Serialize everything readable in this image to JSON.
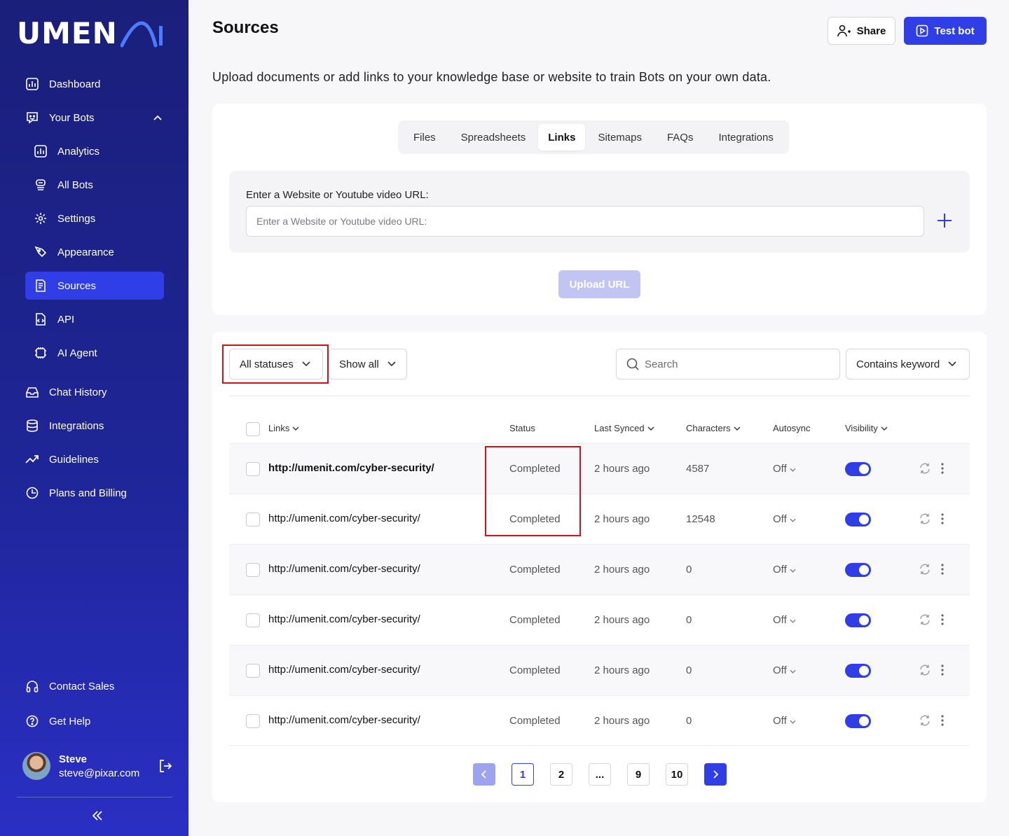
{
  "brand": {
    "logo_text": "UMEN",
    "accent": "#2f3ee6",
    "sidebar_bg": "#1e2596"
  },
  "sidebar": {
    "items": [
      {
        "label": "Dashboard",
        "icon": "dashboard-icon"
      },
      {
        "label": "Your Bots",
        "icon": "bot-icon"
      },
      {
        "label": "Analytics",
        "icon": "chart-icon"
      },
      {
        "label": "All Bots",
        "icon": "bots-icon"
      },
      {
        "label": "Settings",
        "icon": "gear-icon"
      },
      {
        "label": "Appearance",
        "icon": "brush-icon"
      },
      {
        "label": "Sources",
        "icon": "document-icon"
      },
      {
        "label": "API",
        "icon": "code-file-icon"
      },
      {
        "label": "AI Agent",
        "icon": "chip-icon"
      },
      {
        "label": "Chat History",
        "icon": "inbox-icon"
      },
      {
        "label": "Integrations",
        "icon": "database-icon"
      },
      {
        "label": "Guidelines",
        "icon": "trend-icon"
      },
      {
        "label": "Plans and Billing",
        "icon": "clock-icon"
      }
    ],
    "bottom": [
      {
        "label": "Contact Sales",
        "icon": "headset-icon"
      },
      {
        "label": "Get Help",
        "icon": "help-icon"
      }
    ],
    "user": {
      "name": "Steve",
      "email": "steve@pixar.com"
    }
  },
  "header": {
    "title": "Sources",
    "share_label": "Share",
    "test_label": "Test bot",
    "subtitle": "Upload documents or add links to your knowledge base or website to train Bots on your own data."
  },
  "tabs": [
    "Files",
    "Spreadsheets",
    "Links",
    "Sitemaps",
    "FAQs",
    "Integrations"
  ],
  "active_tab": "Links",
  "url_form": {
    "label": "Enter a Website or Youtube video URL:",
    "placeholder": "Enter a Website or Youtube video URL:",
    "upload_label": "Upload URL"
  },
  "filters": {
    "status": "All statuses",
    "show": "Show all",
    "search_placeholder": "Search",
    "match": "Contains keyword"
  },
  "table": {
    "columns": [
      "Links",
      "Status",
      "Last Synced",
      "Characters",
      "Autosync",
      "Visibility"
    ],
    "rows": [
      {
        "link": "http://umenit.com/cyber-security/",
        "status": "Completed",
        "synced": "2 hours ago",
        "chars": "4587",
        "autosync": "Off",
        "visible": true
      },
      {
        "link": "http://umenit.com/cyber-security/",
        "status": "Completed",
        "synced": "2 hours ago",
        "chars": "12548",
        "autosync": "Off",
        "visible": true
      },
      {
        "link": "http://umenit.com/cyber-security/",
        "status": "Completed",
        "synced": "2 hours ago",
        "chars": "0",
        "autosync": "Off",
        "visible": true
      },
      {
        "link": "http://umenit.com/cyber-security/",
        "status": "Completed",
        "synced": "2 hours ago",
        "chars": "0",
        "autosync": "Off",
        "visible": true
      },
      {
        "link": "http://umenit.com/cyber-security/",
        "status": "Completed",
        "synced": "2 hours ago",
        "chars": "0",
        "autosync": "Off",
        "visible": true
      },
      {
        "link": "http://umenit.com/cyber-security/",
        "status": "Completed",
        "synced": "2 hours ago",
        "chars": "0",
        "autosync": "Off",
        "visible": true
      }
    ]
  },
  "pagination": {
    "pages": [
      "1",
      "2",
      "...",
      "9",
      "10"
    ],
    "current": "1"
  }
}
